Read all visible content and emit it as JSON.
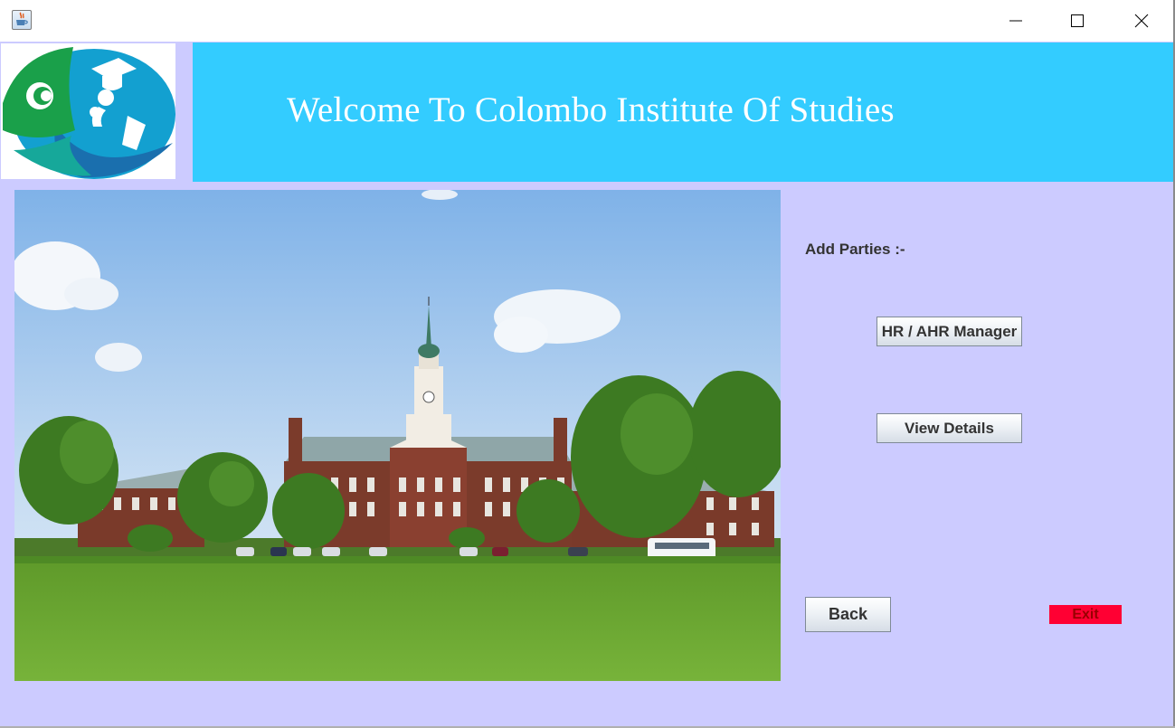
{
  "window": {
    "app_icon": "java-cup-icon",
    "controls": {
      "minimize_icon": "minimize-icon",
      "maximize_icon": "maximize-icon",
      "close_icon": "close-icon"
    }
  },
  "header": {
    "logo_icon": "institute-logo-icon",
    "title": "Welcome To Colombo Institute Of Studies",
    "banner_color": "#33ccff"
  },
  "main": {
    "photo": "campus-building-photo",
    "section_label": "Add Parties :-",
    "buttons": {
      "hr_manager": "HR / AHR Manager",
      "view_details": "View Details",
      "back": "Back",
      "exit": "Exit"
    },
    "exit_color": "#ff0033",
    "background_color": "#cccbff"
  }
}
